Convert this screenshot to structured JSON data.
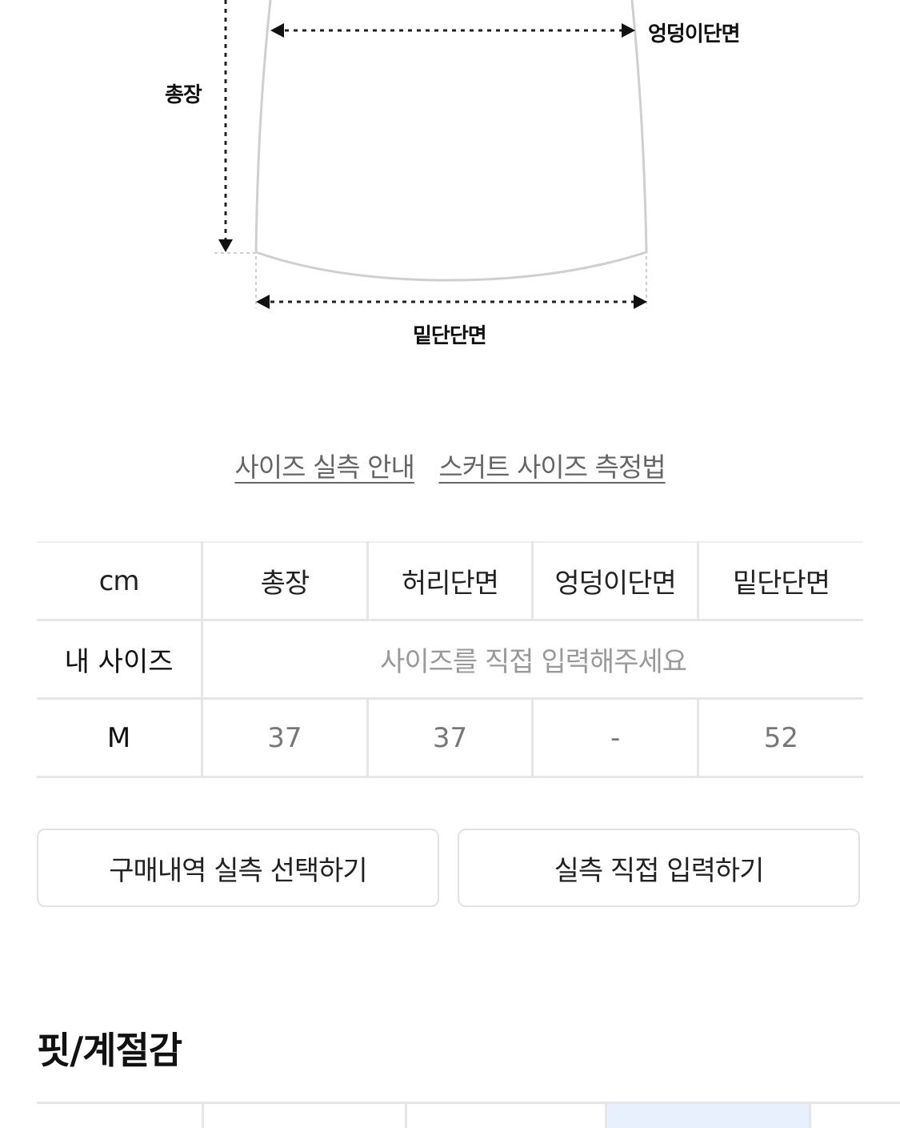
{
  "diagram": {
    "length_label": "총장",
    "hip_label": "엉덩이단면",
    "hem_label": "밑단단면"
  },
  "guide_links": {
    "size_guide": "사이즈 실측 안내",
    "measure_method": "스커트 사이즈 측정법"
  },
  "size_table": {
    "headers": [
      "cm",
      "총장",
      "허리단면",
      "엉덩이단면",
      "밑단단면"
    ],
    "my_size": {
      "label": "내 사이즈",
      "placeholder": "사이즈를 직접 입력해주세요"
    },
    "rows": [
      {
        "size": "M",
        "values": [
          "37",
          "37",
          "-",
          "52"
        ]
      }
    ]
  },
  "buttons": {
    "purchase_history": "구매내역 실측 선택하기",
    "direct_input": "실측 직접 입력하기"
  },
  "fit_section": {
    "title": "핏/계절감",
    "highlight_color": "#e8effd"
  }
}
